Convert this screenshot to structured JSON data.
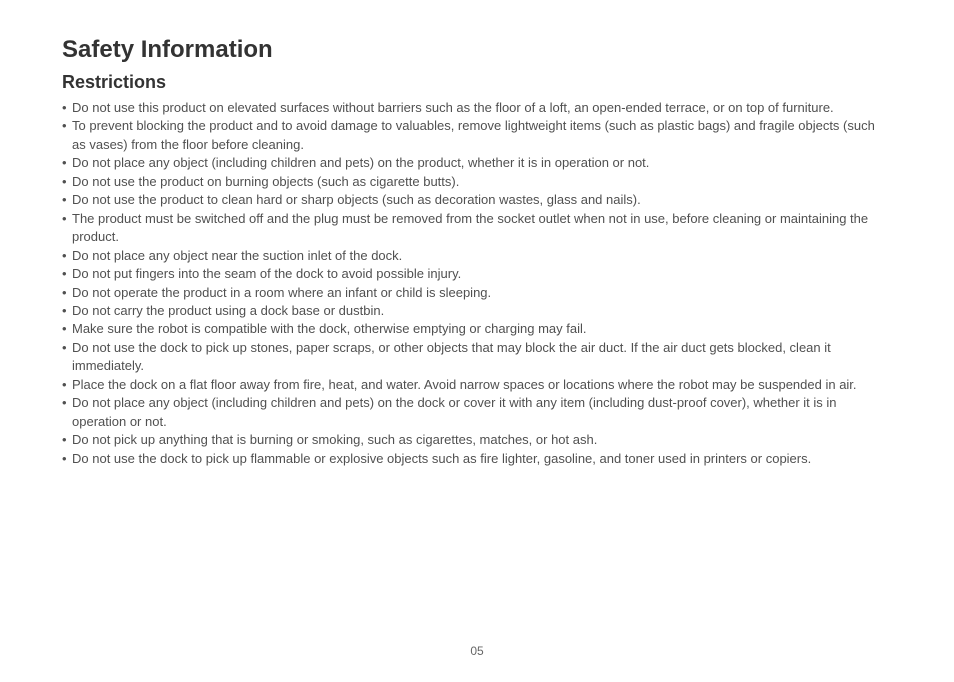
{
  "title": "Safety Information",
  "subtitle": "Restrictions",
  "bullets": [
    "Do not use this product on elevated surfaces without barriers such as the floor of a loft, an open-ended terrace, or on top of furniture.",
    "To prevent blocking the product and to avoid damage to valuables, remove lightweight items (such as plastic bags) and fragile objects (such as vases) from the floor before cleaning.",
    "Do not place any object (including children and pets) on the product, whether it is in operation or not.",
    "Do not use the product on burning objects (such as cigarette butts).",
    "Do not use the product to clean hard or sharp objects (such as decoration wastes, glass and nails).",
    "The product must be switched off and the plug must be removed from the socket outlet when not in use, before cleaning or maintaining the product.",
    "Do not place any object near the suction inlet of the dock.",
    "Do not put fingers into the seam of the dock to avoid possible injury.",
    "Do not operate the product in a room where an infant or child is sleeping.",
    "Do not carry the product using a dock base or dustbin.",
    "Make sure the robot is compatible with the dock, otherwise emptying or charging may fail.",
    "Do not use the dock to pick up stones, paper scraps, or other objects that may block the air duct. If the air duct gets blocked, clean it immediately.",
    "Place the dock on a flat floor away from fire, heat, and water. Avoid narrow spaces or locations where the robot may be suspended in air.",
    "Do not place any object (including children and pets) on the dock or cover it with any item (including dust-proof cover), whether it is in operation or not.",
    "Do not pick up anything that is burning or smoking, such as cigarettes, matches, or hot ash.",
    "Do not use the dock to pick up flammable or explosive objects such as fire lighter, gasoline, and toner used in printers or copiers."
  ],
  "page_number": "05"
}
